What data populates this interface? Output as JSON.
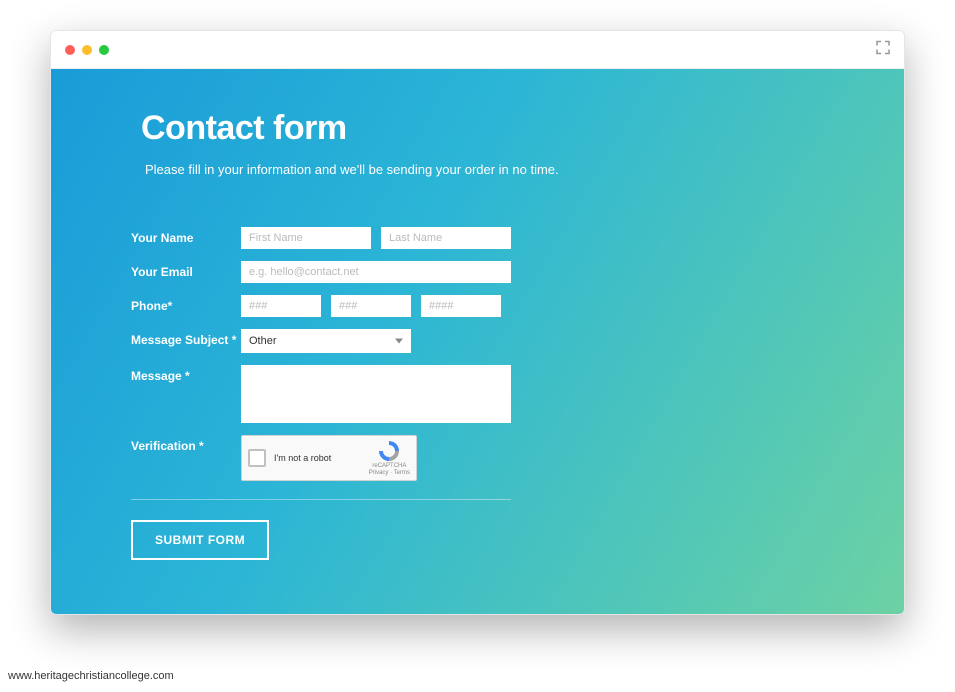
{
  "form": {
    "title": "Contact form",
    "subtitle": "Please fill in your information and we'll be sending your order in no time.",
    "labels": {
      "name": "Your Name",
      "email": "Your Email",
      "phone": "Phone*",
      "subject": "Message Subject *",
      "message": "Message *",
      "verification": "Verification *"
    },
    "placeholders": {
      "first_name": "First Name",
      "last_name": "Last Name",
      "email": "e.g. hello@contact.net",
      "phone1": "###",
      "phone2": "###",
      "phone3": "####"
    },
    "subject_selected": "Other",
    "captcha": {
      "text": "I'm not a robot",
      "brand": "reCAPTCHA",
      "legal": "Privacy · Terms"
    },
    "submit_label": "SUBMIT FORM"
  },
  "watermark": "www.heritagechristiancollege.com"
}
